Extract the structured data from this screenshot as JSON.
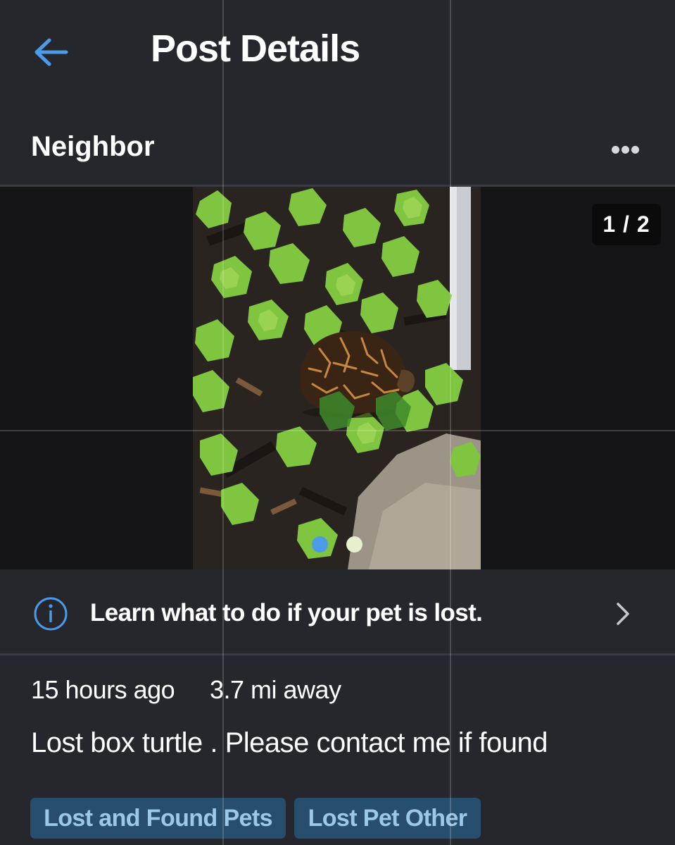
{
  "header": {
    "back_icon": "arrow-left-icon",
    "title": "Post Details"
  },
  "author": {
    "name": "Neighbor",
    "more_icon": "more-horizontal-icon"
  },
  "media": {
    "image_alt": "box turtle among green leaves",
    "counter": "1 / 2",
    "current_index": 1,
    "total": 2
  },
  "info_banner": {
    "icon": "info-circle-icon",
    "text": "Learn what to do if your pet is lost.",
    "chevron_icon": "chevron-right-icon"
  },
  "post": {
    "time": "15 hours ago",
    "distance": "3.7 mi away",
    "body": "Lost box turtle . Please contact me if found"
  },
  "tags": [
    {
      "label": "Lost and Found Pets"
    },
    {
      "label": "Lost Pet Other"
    }
  ],
  "colors": {
    "background": "#26272d",
    "accent": "#4c9be8",
    "tag_bg": "#284e6e",
    "tag_text": "#9cc8e8"
  }
}
